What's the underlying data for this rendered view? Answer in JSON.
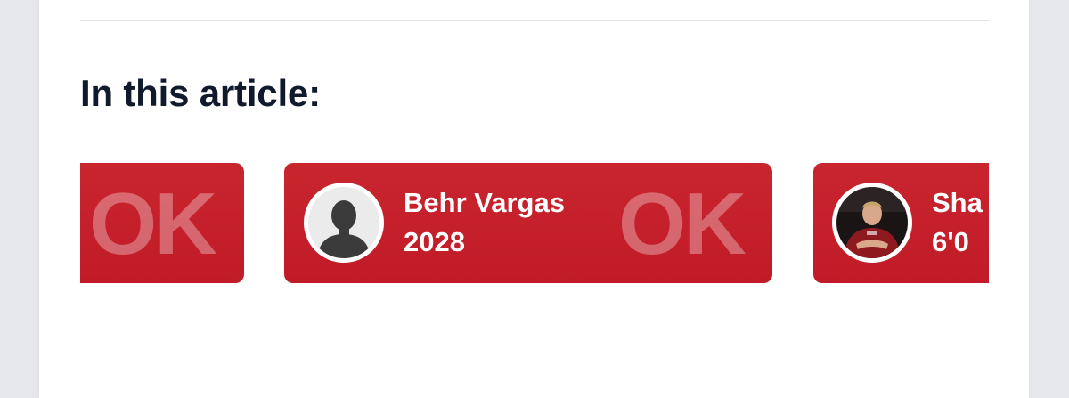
{
  "section": {
    "heading": "In this article:"
  },
  "colors": {
    "card_red": "#c4202b",
    "heading_text": "#101a2c",
    "divider": "#e2e4ea"
  },
  "players": [
    {
      "watermark": "OK",
      "name": "",
      "meta": "",
      "avatar": "none"
    },
    {
      "watermark": "OK",
      "name": "Behr Vargas",
      "meta": "2028",
      "avatar": "default-silhouette-icon"
    },
    {
      "watermark": "",
      "name": "Sha",
      "meta": "6'0",
      "avatar": "player-photo"
    }
  ]
}
